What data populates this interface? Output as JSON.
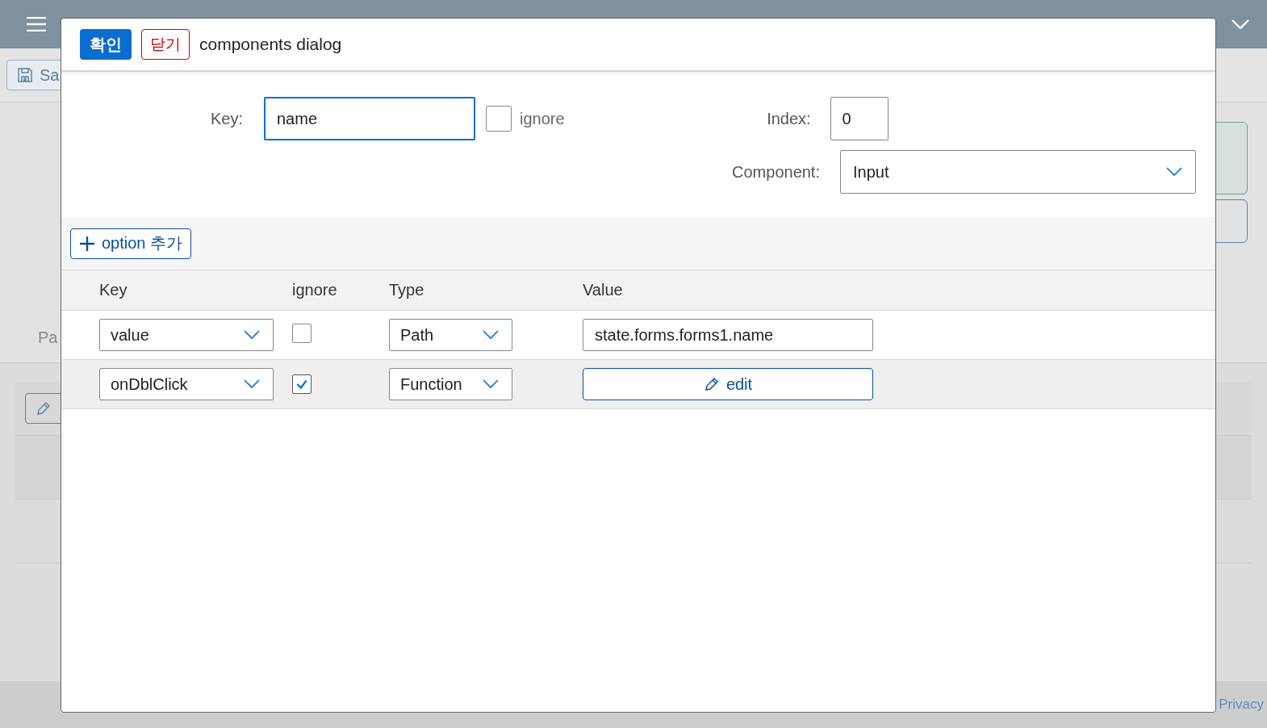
{
  "dialog": {
    "confirm_button": "확인",
    "close_button": "닫기",
    "title": "components dialog",
    "key": {
      "label": "Key:",
      "value": "name"
    },
    "ignore": {
      "label": "ignore",
      "checked": false
    },
    "index": {
      "label": "Index:",
      "value": "0"
    },
    "component": {
      "label": "Component:",
      "value": "Input"
    },
    "add_option_button": "option 추가",
    "columns": [
      "Key",
      "ignore",
      "Type",
      "Value"
    ],
    "rows": [
      {
        "key": "value",
        "ignore": false,
        "type": "Path",
        "kind": "input",
        "value": "state.forms.forms1.name"
      },
      {
        "key": "onDblClick",
        "ignore": true,
        "type": "Function",
        "kind": "button",
        "value": "edit"
      }
    ]
  },
  "background": {
    "save_button": "Sa",
    "field_label": "Pa",
    "footer_link": "Privacy"
  }
}
